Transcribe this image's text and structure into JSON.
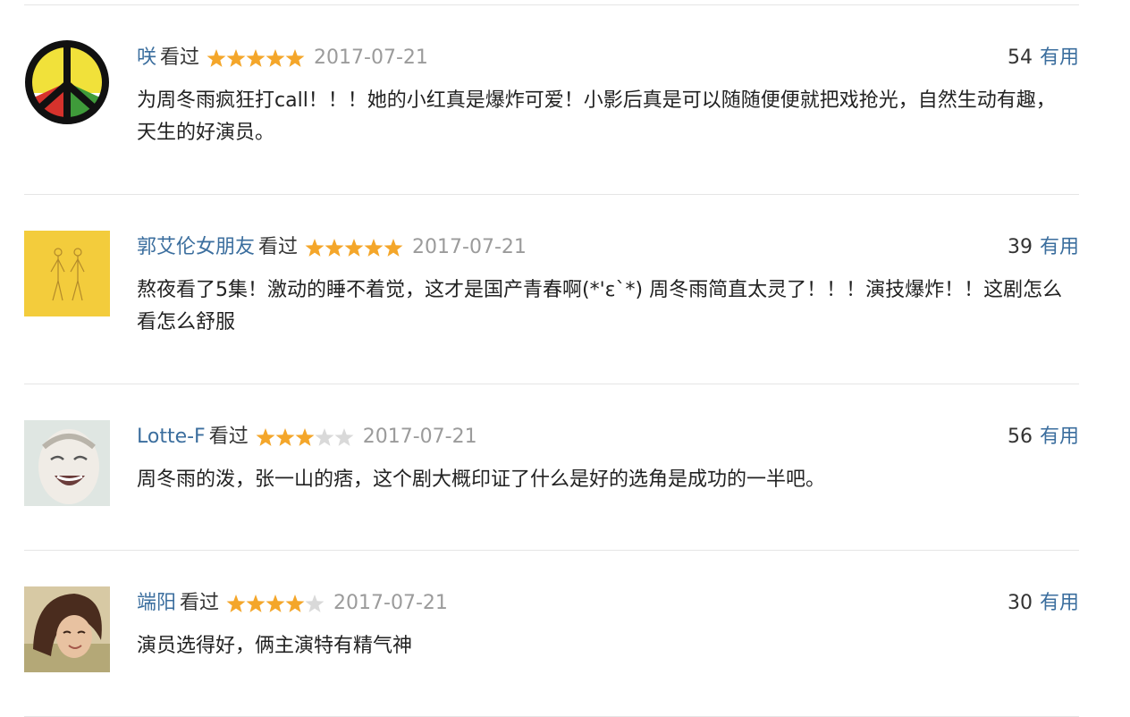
{
  "comments": [
    {
      "author": "咲",
      "status": "看过",
      "rating": 5,
      "date": "2017-07-21",
      "votes": "54",
      "useful_label": "有用",
      "text": "为周冬雨疯狂打call！！！她的小红真是爆炸可爱！小影后真是可以随随便便就把戏抢光，自然生动有趣，天生的好演员。",
      "avatar_icon": "peace-sign-icon"
    },
    {
      "author": "郭艾伦女朋友",
      "status": "看过",
      "rating": 5,
      "date": "2017-07-21",
      "votes": "39",
      "useful_label": "有用",
      "text": "熬夜看了5集！激动的睡不着觉，这才是国产青春啊(*'ε`*) 周冬雨简直太灵了！！！演技爆炸！！这剧怎么看怎么舒服",
      "avatar_icon": "two-figures-yellow-icon"
    },
    {
      "author": "Lotte-F",
      "status": "看过",
      "rating": 3,
      "date": "2017-07-21",
      "votes": "56",
      "useful_label": "有用",
      "text": "周冬雨的泼，张一山的痞，这个剧大概印证了什么是好的选角是成功的一半吧。",
      "avatar_icon": "laughing-face-icon"
    },
    {
      "author": "端阳",
      "status": "看过",
      "rating": 4,
      "date": "2017-07-21",
      "votes": "30",
      "useful_label": "有用",
      "text": "演员选得好，俩主演特有精气神",
      "avatar_icon": "girl-portrait-icon"
    }
  ],
  "colors": {
    "author_link": "#3b6e9e",
    "star_on": "#f4a62a",
    "star_off": "#d9d9d9",
    "date": "#9b9b9b",
    "divider": "#e5e5e5"
  }
}
